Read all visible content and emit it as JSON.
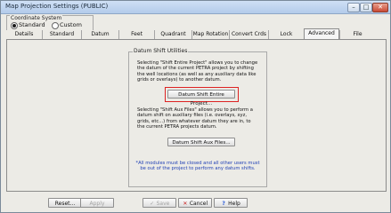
{
  "window": {
    "title": "Map Projection Settings (PUBLIC)"
  },
  "coordinate_system": {
    "label": "Coordinate System",
    "options": [
      {
        "label": "Standard",
        "selected": true
      },
      {
        "label": "Custom",
        "selected": false
      }
    ]
  },
  "tabs": [
    {
      "label": "Details"
    },
    {
      "label": "Standard"
    },
    {
      "label": "Datum"
    },
    {
      "label": "Feet"
    },
    {
      "label": "Quadrant"
    },
    {
      "label": "Map Rotation"
    },
    {
      "label": "Convert Crds"
    },
    {
      "label": "Lock"
    },
    {
      "label": "Advanced",
      "active": true
    },
    {
      "label": "File"
    }
  ],
  "datum_shift": {
    "group_label": "Datum Shift Utilities",
    "text1": "Selecting \"Shift Entire Project\" allows you to change the datum of the current PETRA project by shifting the well locations (as well as any auxiliary data like grids or overlays) to another datum.",
    "button1": "Datum Shift Entire Project...",
    "text2": "Selecting \"Shift Aux Files\" allows you to perform a datum shift on auxiliary files (i.e. overlays, xyz, grids, etc...) from whatever datum they are in, to the current PETRA projects datum.",
    "button2": "Datum Shift Aux Files...",
    "note": "*All modules must be closed and all other users must be out of the project to perform any datum shifts."
  },
  "buttons": {
    "reset": "Reset...",
    "apply": "Apply",
    "save": "Save",
    "cancel": "Cancel",
    "help": "Help"
  },
  "colors": {
    "highlight": "#d22222",
    "note_text": "#1f3fb5"
  }
}
